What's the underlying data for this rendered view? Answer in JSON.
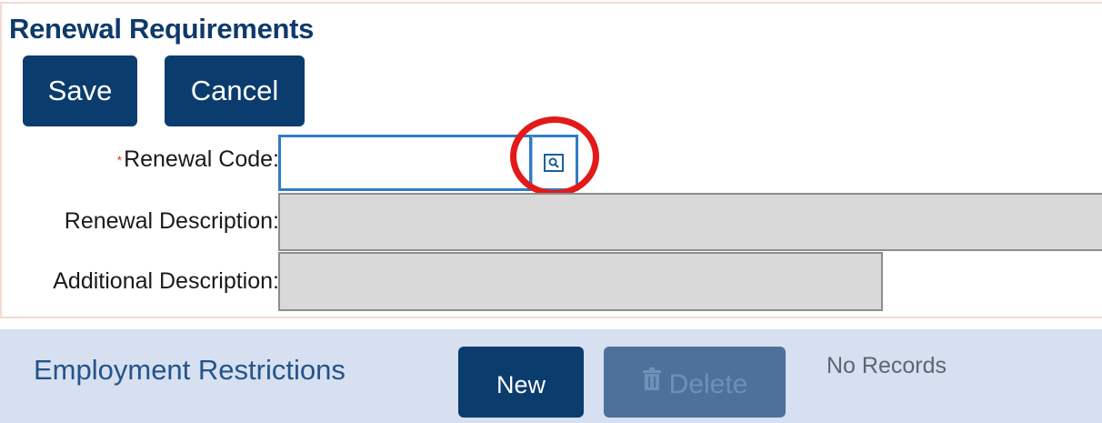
{
  "section": {
    "title": "Renewal Requirements",
    "buttons": {
      "save_label": "Save",
      "cancel_label": "Cancel"
    },
    "fields": {
      "renewal_code": {
        "required_marker": "*",
        "label": "Renewal Code:",
        "value": ""
      },
      "renewal_description": {
        "label": "Renewal Description:",
        "value": ""
      },
      "additional_description": {
        "label": "Additional Description:",
        "value": ""
      }
    },
    "lookup_icon": "search-lookup-icon"
  },
  "employment_restrictions": {
    "title": "Employment Restrictions",
    "new_label": "New",
    "delete_label": "Delete",
    "status": "No Records"
  },
  "colors": {
    "primary": "#0b3c6e",
    "accent": "#2f7ec3",
    "highlight": "#e21a1a",
    "disabled": "#4e719c",
    "strip_bg": "#d6e0f1",
    "readonly_bg": "#d9d9d9"
  }
}
